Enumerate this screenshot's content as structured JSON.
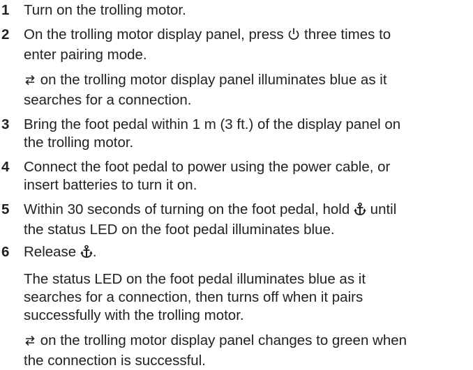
{
  "steps": [
    {
      "number": "1",
      "text": [
        "Turn on the trolling motor."
      ]
    },
    {
      "number": "2",
      "text_a": "On the trolling motor display panel, press",
      "icon_a": "power-icon",
      "text_b": "three times to",
      "text_c": "enter pairing mode.",
      "note_icon": "pairing-arrows-icon",
      "note_a": "on the trolling motor display panel illuminates blue as it",
      "note_b": "searches for a connection."
    },
    {
      "number": "3",
      "text": [
        "Bring the foot pedal within 1 m (3 ft.) of the display panel on",
        "the trolling motor."
      ]
    },
    {
      "number": "4",
      "text": [
        "Connect the foot pedal to power using the power cable, or",
        "insert batteries to turn it on."
      ]
    },
    {
      "number": "5",
      "text_a": "Within 30 seconds of turning on the foot pedal, hold",
      "icon_a": "anchor-icon",
      "text_b": "until",
      "text_c": "the status LED on the foot pedal illuminates blue."
    },
    {
      "number": "6",
      "text_a": "Release",
      "icon_a": "anchor-icon",
      "text_b": ".",
      "note1": [
        "The status LED on the foot pedal illuminates blue as it",
        "searches for a connection, then turns off when it pairs",
        "successfully with the trolling motor."
      ],
      "note2_icon": "pairing-arrows-icon",
      "note2_a": "on the trolling motor display panel changes to green when",
      "note2_b": "the connection is successful."
    }
  ]
}
